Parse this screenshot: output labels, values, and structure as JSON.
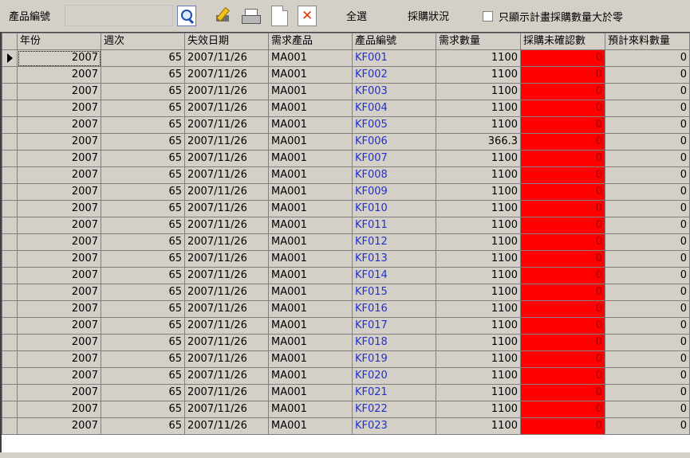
{
  "toolbar": {
    "product_label": "產品編號",
    "product_value": "",
    "icons": [
      "search-icon",
      "edit-icon",
      "print-icon",
      "new-document-icon",
      "delete-icon"
    ],
    "select_all": "全選",
    "purchase_status": "採購狀況",
    "only_show_label": "只顯示計畫採購數量大於零",
    "only_show_checked": false
  },
  "grid": {
    "headers": [
      "年份",
      "週次",
      "失效日期",
      "需求產品",
      "產品編號",
      "需求數量",
      "採購未確認數",
      "預計來料數量"
    ],
    "highlight_color": "#ff0000",
    "link_color": "#1f2fd0",
    "rows": [
      [
        "2007",
        "65",
        "2007/11/26",
        "MA001",
        "KF001",
        "1100",
        "0",
        "0"
      ],
      [
        "2007",
        "65",
        "2007/11/26",
        "MA001",
        "KF002",
        "1100",
        "0",
        "0"
      ],
      [
        "2007",
        "65",
        "2007/11/26",
        "MA001",
        "KF003",
        "1100",
        "0",
        "0"
      ],
      [
        "2007",
        "65",
        "2007/11/26",
        "MA001",
        "KF004",
        "1100",
        "0",
        "0"
      ],
      [
        "2007",
        "65",
        "2007/11/26",
        "MA001",
        "KF005",
        "1100",
        "0",
        "0"
      ],
      [
        "2007",
        "65",
        "2007/11/26",
        "MA001",
        "KF006",
        "366.3",
        "0",
        "0"
      ],
      [
        "2007",
        "65",
        "2007/11/26",
        "MA001",
        "KF007",
        "1100",
        "0",
        "0"
      ],
      [
        "2007",
        "65",
        "2007/11/26",
        "MA001",
        "KF008",
        "1100",
        "0",
        "0"
      ],
      [
        "2007",
        "65",
        "2007/11/26",
        "MA001",
        "KF009",
        "1100",
        "0",
        "0"
      ],
      [
        "2007",
        "65",
        "2007/11/26",
        "MA001",
        "KF010",
        "1100",
        "0",
        "0"
      ],
      [
        "2007",
        "65",
        "2007/11/26",
        "MA001",
        "KF011",
        "1100",
        "0",
        "0"
      ],
      [
        "2007",
        "65",
        "2007/11/26",
        "MA001",
        "KF012",
        "1100",
        "0",
        "0"
      ],
      [
        "2007",
        "65",
        "2007/11/26",
        "MA001",
        "KF013",
        "1100",
        "0",
        "0"
      ],
      [
        "2007",
        "65",
        "2007/11/26",
        "MA001",
        "KF014",
        "1100",
        "0",
        "0"
      ],
      [
        "2007",
        "65",
        "2007/11/26",
        "MA001",
        "KF015",
        "1100",
        "0",
        "0"
      ],
      [
        "2007",
        "65",
        "2007/11/26",
        "MA001",
        "KF016",
        "1100",
        "0",
        "0"
      ],
      [
        "2007",
        "65",
        "2007/11/26",
        "MA001",
        "KF017",
        "1100",
        "0",
        "0"
      ],
      [
        "2007",
        "65",
        "2007/11/26",
        "MA001",
        "KF018",
        "1100",
        "0",
        "0"
      ],
      [
        "2007",
        "65",
        "2007/11/26",
        "MA001",
        "KF019",
        "1100",
        "0",
        "0"
      ],
      [
        "2007",
        "65",
        "2007/11/26",
        "MA001",
        "KF020",
        "1100",
        "0",
        "0"
      ],
      [
        "2007",
        "65",
        "2007/11/26",
        "MA001",
        "KF021",
        "1100",
        "0",
        "0"
      ],
      [
        "2007",
        "65",
        "2007/11/26",
        "MA001",
        "KF022",
        "1100",
        "0",
        "0"
      ],
      [
        "2007",
        "65",
        "2007/11/26",
        "MA001",
        "KF023",
        "1100",
        "0",
        "0"
      ]
    ]
  }
}
